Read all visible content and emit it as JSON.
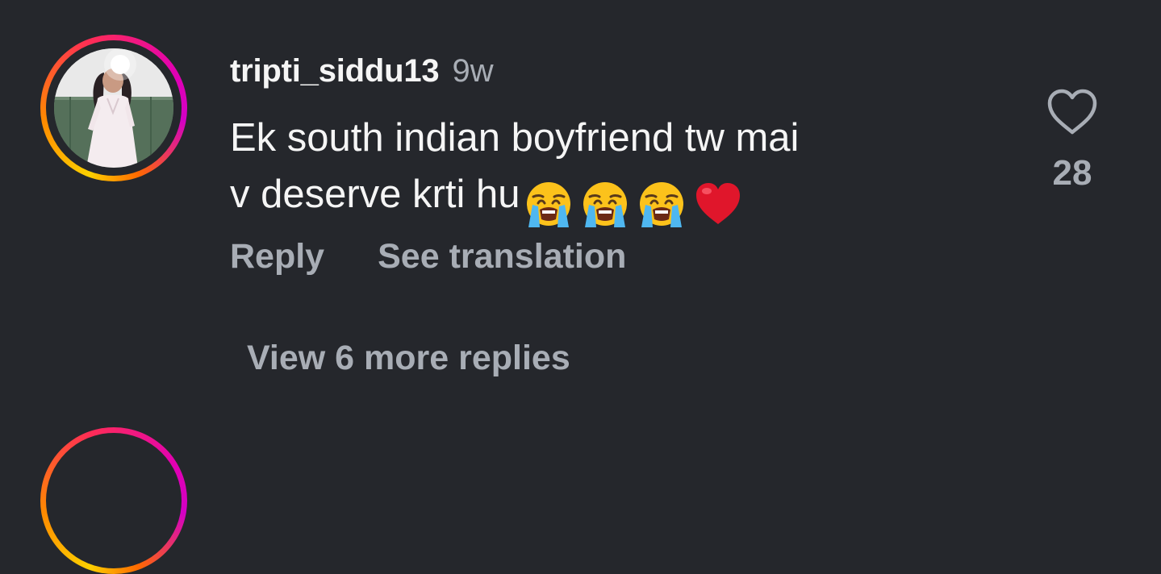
{
  "comment": {
    "username": "tripti_siddu13",
    "timestamp": "9w",
    "text_line_1": "Ek south indian boyfriend tw mai",
    "text_line_2": "v deserve krti hu",
    "emojis": [
      "😭",
      "😭",
      "😭",
      "❤️"
    ],
    "actions": {
      "reply_label": "Reply",
      "translate_label": "See translation"
    },
    "like_count": "28",
    "view_more_label": "View 6 more replies"
  },
  "icons": {
    "like": "heart-outline-icon",
    "emoji_crying": "loudly-crying-face-emoji",
    "emoji_heart": "red-heart-emoji"
  },
  "colors": {
    "background": "#25272c",
    "text_primary": "#f5f5f5",
    "text_secondary": "#a8adb5",
    "story_ring_start": "#fcd000",
    "story_ring_end": "#d300c5",
    "heart_emoji": "#e0162b"
  }
}
